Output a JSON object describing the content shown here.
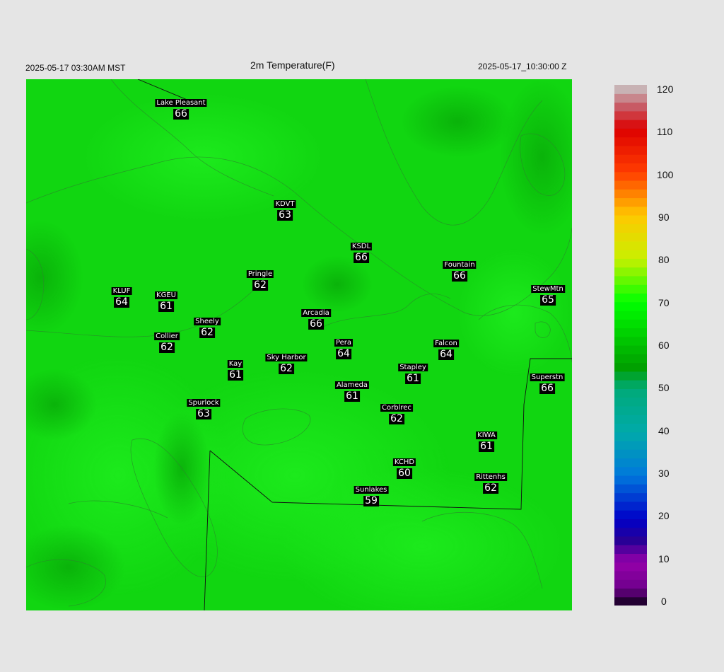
{
  "header": {
    "local_time": "2025-05-17 03:30AM MST",
    "title": "2m Temperature(F)",
    "utc_time": "2025-05-17_10:30:00 Z"
  },
  "map": {
    "field_color": "#11d611",
    "stations": [
      {
        "name": "Lake Pleasant",
        "value": "66"
      },
      {
        "name": "KDVT",
        "value": "63"
      },
      {
        "name": "KSDL",
        "value": "66"
      },
      {
        "name": "Fountain",
        "value": "66"
      },
      {
        "name": "Pringle",
        "value": "62"
      },
      {
        "name": "KLUF",
        "value": "64"
      },
      {
        "name": "KGEU",
        "value": "61"
      },
      {
        "name": "StewMtn",
        "value": "65"
      },
      {
        "name": "Arcadia",
        "value": "66"
      },
      {
        "name": "Sheely",
        "value": "62"
      },
      {
        "name": "Collier",
        "value": "62"
      },
      {
        "name": "Pera",
        "value": "64"
      },
      {
        "name": "Falcon",
        "value": "64"
      },
      {
        "name": "Kay",
        "value": "61"
      },
      {
        "name": "Sky Harbor",
        "value": "62"
      },
      {
        "name": "Stapley",
        "value": "61"
      },
      {
        "name": "Superstn",
        "value": "66"
      },
      {
        "name": "Alameda",
        "value": "61"
      },
      {
        "name": "Spurlock",
        "value": "63"
      },
      {
        "name": "Corblrec",
        "value": "62"
      },
      {
        "name": "KIWA",
        "value": "61"
      },
      {
        "name": "KCHD",
        "value": "60"
      },
      {
        "name": "Rittenhs",
        "value": "62"
      },
      {
        "name": "Sunlakes",
        "value": "59"
      }
    ]
  },
  "colorbar": {
    "ticks": [
      "120",
      "110",
      "100",
      "90",
      "80",
      "70",
      "60",
      "50",
      "40",
      "30",
      "20",
      "10",
      "0"
    ]
  }
}
